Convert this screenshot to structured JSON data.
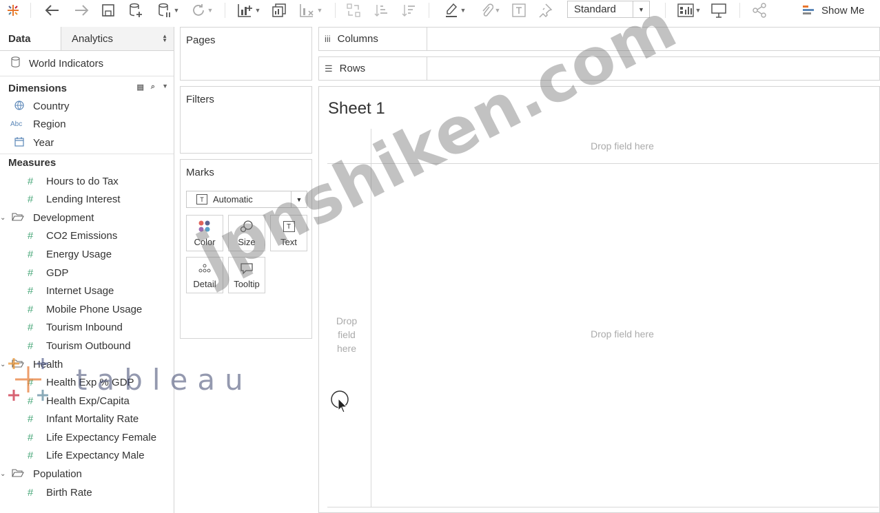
{
  "toolbar": {
    "mark_size_select": "Standard",
    "show_me_label": "Show Me"
  },
  "left_panel": {
    "tabs": [
      {
        "label": "Data"
      },
      {
        "label": "Analytics"
      }
    ],
    "datasource": "World Indicators",
    "dimensions_header": "Dimensions",
    "dimensions": [
      {
        "icon": "globe-icon",
        "label": "Country"
      },
      {
        "icon": "abc-icon",
        "type_label": "Abc",
        "label": "Region"
      },
      {
        "icon": "calendar-icon",
        "label": "Year"
      }
    ],
    "measures_header": "Measures",
    "measures_top": [
      "Hours to do Tax",
      "Lending Interest"
    ],
    "folders": [
      {
        "name": "Development",
        "items": [
          "CO2 Emissions",
          "Energy Usage",
          "GDP",
          "Internet Usage",
          "Mobile Phone Usage",
          "Tourism Inbound",
          "Tourism Outbound"
        ]
      },
      {
        "name": "Health",
        "items": [
          "Health Exp % GDP",
          "Health Exp/Capita",
          "Infant Mortality Rate",
          "Life Expectancy Female",
          "Life Expectancy Male"
        ]
      },
      {
        "name": "Population",
        "items": [
          "Birth Rate"
        ]
      }
    ]
  },
  "cards": {
    "pages": "Pages",
    "filters": "Filters",
    "marks": "Marks",
    "mark_type": "Automatic",
    "mark_type_icon_letter": "T",
    "mark_buttons": [
      {
        "icon": "color-icon",
        "label": "Color"
      },
      {
        "icon": "size-icon",
        "label": "Size"
      },
      {
        "icon": "text-icon",
        "icon_letter": "T",
        "label": "Text"
      },
      {
        "icon": "detail-icon",
        "label": "Detail"
      },
      {
        "icon": "tooltip-icon",
        "label": "Tooltip"
      }
    ]
  },
  "shelves": {
    "columns": "Columns",
    "rows": "Rows"
  },
  "view": {
    "sheet_title": "Sheet 1",
    "drop_columns": "Drop field here",
    "drop_rows": "Drop field here",
    "drop_center": "Drop field here"
  },
  "overlay": {
    "watermark": "jpnshiken.com",
    "logo_text": "tableau"
  },
  "colors": {
    "measure_hash": "#4aa87a",
    "dimension_icon": "#5b87b8",
    "border": "#d4d4d4"
  }
}
